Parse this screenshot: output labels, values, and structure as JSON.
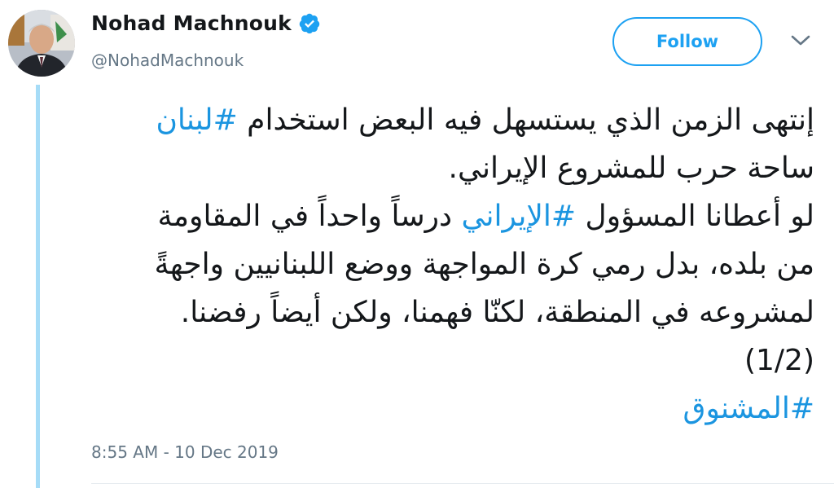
{
  "user": {
    "display_name": "Nohad Machnouk",
    "handle": "@NohadMachnouk",
    "verified_icon": "verified-badge-icon",
    "avatar_icon": "profile-photo"
  },
  "actions": {
    "follow_label": "Follow",
    "menu_icon": "chevron-down-icon"
  },
  "tweet": {
    "line1_text": "إنتهى الزمن الذي يستسهل فيه البعض استخدام ",
    "line1_hashtag": "#لبنان",
    "line2_text": "ساحة حرب للمشروع الإيراني.",
    "line3_text_before": "لو أعطانا المسؤول ",
    "line3_hashtag": "#الإيراني",
    "line3_text_after": " درساً واحداً في المقاومة",
    "line4_text": "من بلده، بدل رمي كرة المواجهة ووضع اللبنانيين واجهةً",
    "line5_text": "لمشروعه في المنطقة، لكنّا فهمنا، ولكن أيضاً رفضنا.",
    "line6_text": "(1/2)",
    "line7_hashtag": "#المشنوق"
  },
  "timestamp": "8:55 AM - 10 Dec 2019",
  "colors": {
    "accent": "#1da1f2",
    "hashtag": "#1b95e0",
    "text": "#14171a",
    "secondary": "#657786",
    "thread_line": "#a6dcf7"
  }
}
